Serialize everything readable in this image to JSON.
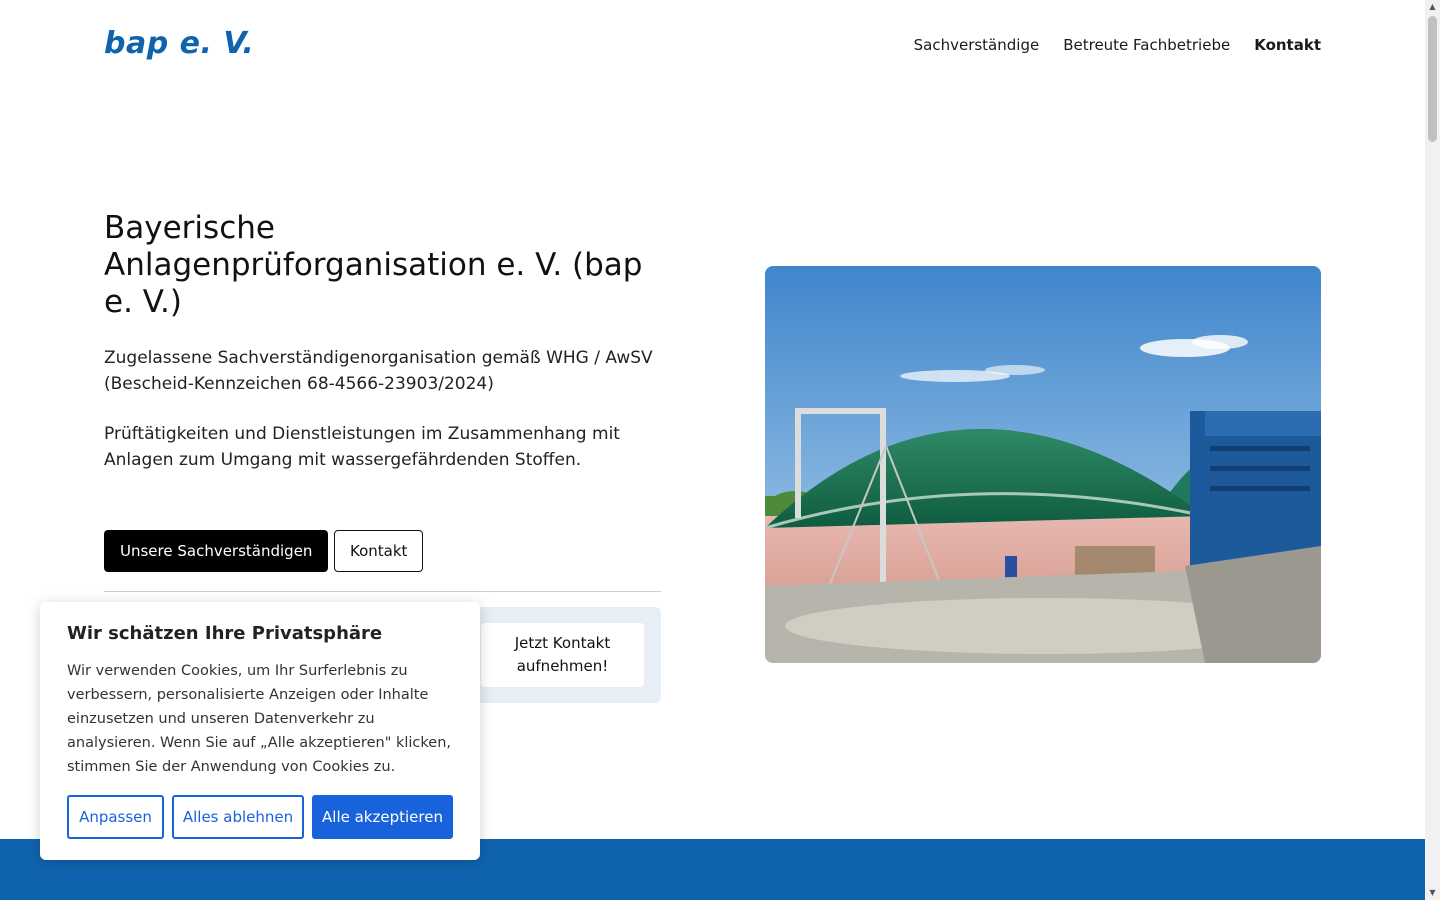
{
  "header": {
    "logo": "bap e. V.",
    "nav": [
      {
        "label": "Sachverständige"
      },
      {
        "label": "Betreute Fachbetriebe"
      },
      {
        "label": "Kontakt",
        "active": true
      }
    ]
  },
  "hero": {
    "title": "Bayerische Anlagenprüforganisation e. V. (bap e. V.)",
    "paragraph1": "Zugelassene Sachverständigenorganisation gemäß WHG / AwSV (Bescheid-Kennzeichen 68-4566-23903/2024)",
    "paragraph2": "Prüftätigkeiten und Dienstleistungen im Zusammenhang mit Anlagen zum Umgang mit wassergefährdenden Stoffen.",
    "primary_button": "Unsere Sachverständigen",
    "secondary_button": "Kontakt",
    "contact_cta": "Jetzt Kontakt aufnehmen!"
  },
  "cookie_banner": {
    "title": "Wir schätzen Ihre Privatsphäre",
    "text": "Wir verwenden Cookies, um Ihr Surferlebnis zu verbessern, personalisierte Anzeigen oder Inhalte einzusetzen und unseren Datenverkehr zu analysieren. Wenn Sie auf „Alle akzeptieren\" klicken, stimmen Sie der Anwendung von Cookies zu.",
    "customize": "Anpassen",
    "reject": "Alles ablehnen",
    "accept": "Alle akzeptieren"
  },
  "colors": {
    "brand_blue": "#0f63ae",
    "cookie_accent": "#1863dc",
    "contact_box_bg": "#e7eef6"
  },
  "icons": {
    "scroll_up": "triangle-up-icon",
    "scroll_down": "triangle-down-icon"
  }
}
